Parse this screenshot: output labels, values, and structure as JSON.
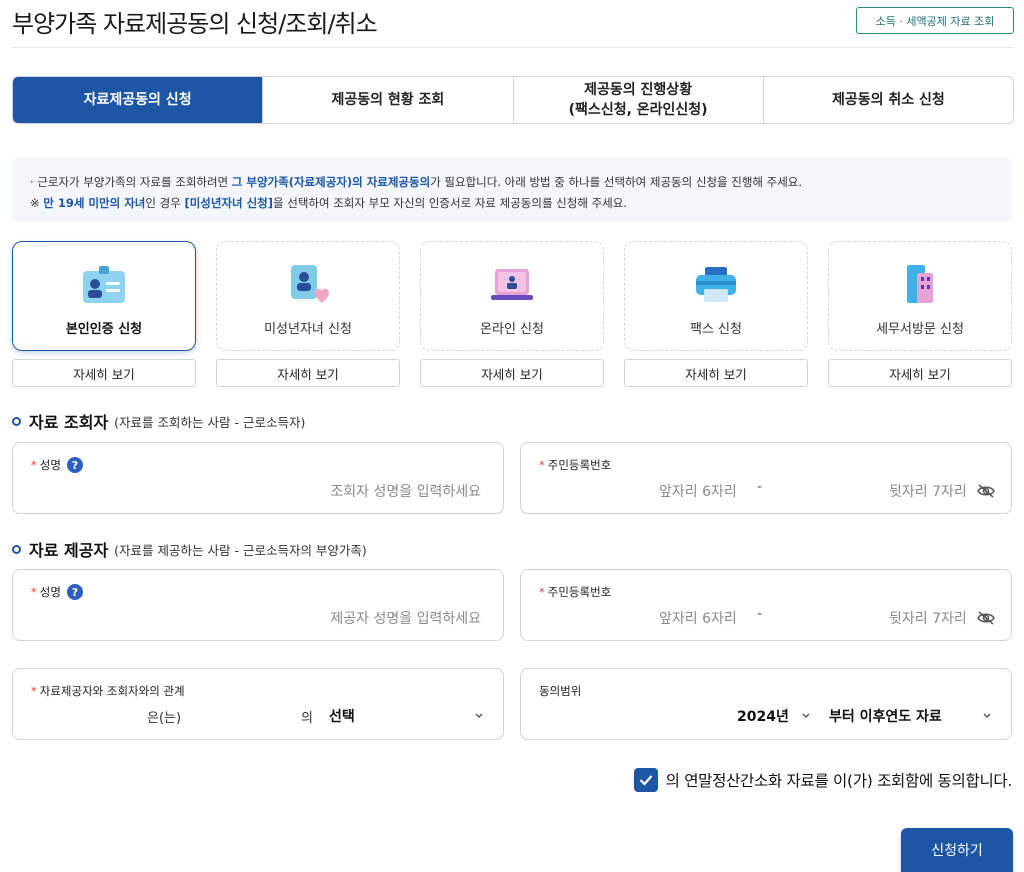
{
  "page": {
    "title": "부양가족 자료제공동의 신청/조회/취소",
    "top_link": "소득 · 세액공제 자료 조회"
  },
  "tabs": [
    {
      "line1": "자료제공동의 신청",
      "line2": "",
      "active": true
    },
    {
      "line1": "제공동의 현황 조회",
      "line2": "",
      "active": false
    },
    {
      "line1": "제공동의 진행상황",
      "line2": "(팩스신청, 온라인신청)",
      "active": false
    },
    {
      "line1": "제공동의 취소 신청",
      "line2": "",
      "active": false
    }
  ],
  "notice": {
    "l1_pre": "근로자가 부양가족의 자료를 조회하려면 ",
    "l1_hl": "그 부양가족(자료제공자)의 자료제공동의",
    "l1_post": "가 필요합니다. 아래 방법 중 하나를 선택하여 제공동의 신청을 진행해 주세요.",
    "l2_pre": "※ ",
    "l2_hl1": "만 19세 미만의 자녀",
    "l2_mid": "인 경우 ",
    "l2_hl2": "[미성년자녀 신청]",
    "l2_post": "을 선택하여 조회자 부모 자신의 인증서로 자료 제공동의를 신청해 주세요."
  },
  "methods": [
    {
      "label": "본인인증 신청",
      "icon": "id-card-icon",
      "selected": true,
      "detail": "자세히 보기"
    },
    {
      "label": "미성년자녀 신청",
      "icon": "child-heart-icon",
      "selected": false,
      "detail": "자세히 보기"
    },
    {
      "label": "온라인 신청",
      "icon": "laptop-icon",
      "selected": false,
      "detail": "자세히 보기"
    },
    {
      "label": "팩스 신청",
      "icon": "printer-icon",
      "selected": false,
      "detail": "자세히 보기"
    },
    {
      "label": "세무서방문 신청",
      "icon": "building-icon",
      "selected": false,
      "detail": "자세히 보기"
    }
  ],
  "viewer": {
    "title": "자료 조회자",
    "subtitle": "(자료를 조회하는 사람 - 근로소득자)",
    "name_label": "성명",
    "name_placeholder": "조회자 성명을 입력하세요",
    "rrn_label": "주민등록번호",
    "rrn_front_placeholder": "앞자리 6자리",
    "rrn_back_placeholder": "뒷자리 7자리",
    "dash": "-"
  },
  "provider": {
    "title": "자료 제공자",
    "subtitle": "(자료를 제공하는 사람 - 근로소득자의 부양가족)",
    "name_label": "성명",
    "name_placeholder": "제공자 성명을 입력하세요",
    "rrn_label": "주민등록번호",
    "rrn_front_placeholder": "앞자리 6자리",
    "rrn_back_placeholder": "뒷자리 7자리",
    "dash": "-"
  },
  "relation": {
    "label": "자료제공자와 조회자와의 관계",
    "text1": "은(는)",
    "text2": "의",
    "select_value": "선택"
  },
  "scope": {
    "label": "동의범위",
    "year_value": "2024년",
    "range_value": "부터 이후연도 자료"
  },
  "consent": {
    "checked": true,
    "text": "의 연말정산간소화 자료를 이(가) 조회함에 동의합니다."
  },
  "submit_label": "신청하기",
  "colors": {
    "primary": "#1e56a6",
    "required": "#e03b3b",
    "teal": "#2a8a8a"
  }
}
